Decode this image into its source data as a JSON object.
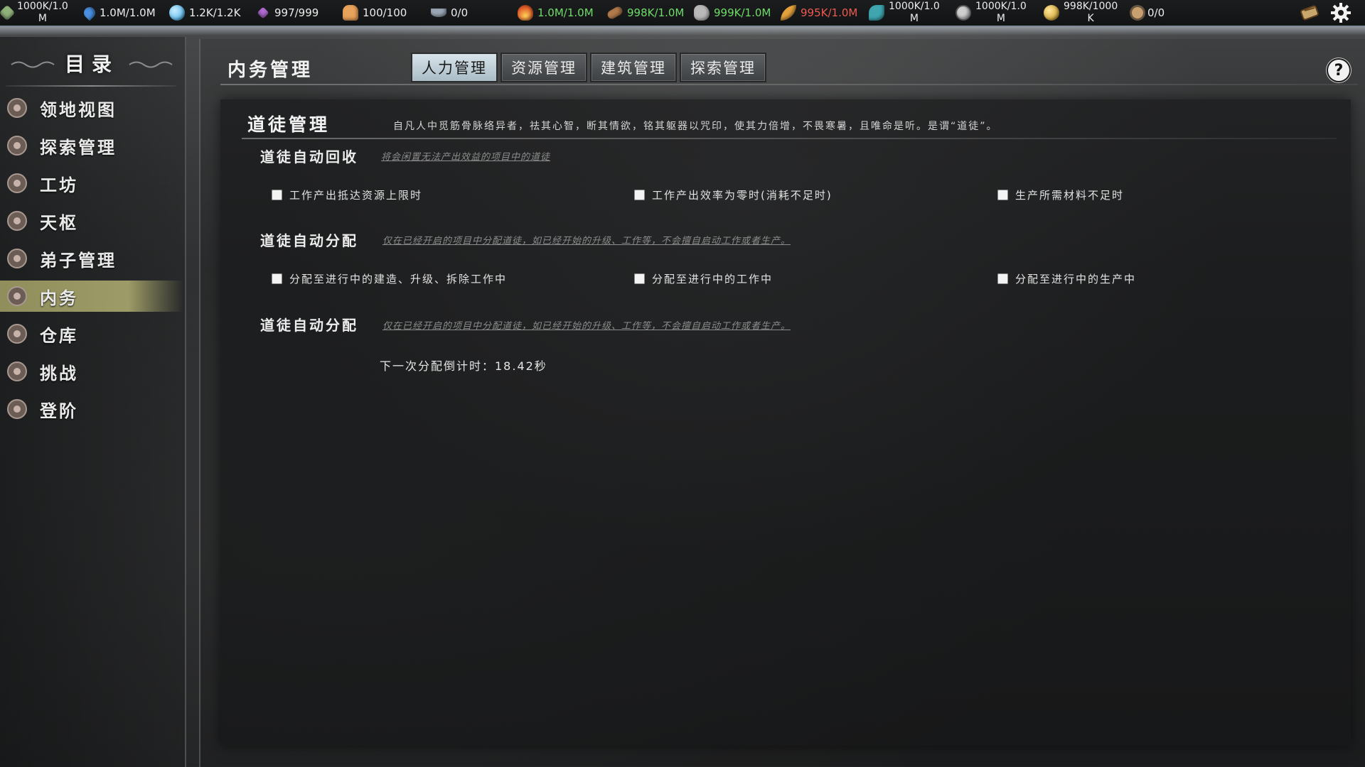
{
  "resources": [
    {
      "icon": "leaf-resource-icon",
      "value_line1": "1000K/1.0",
      "value_line2": "M",
      "style": "white",
      "color": "#8fb27a"
    },
    {
      "icon": "water-drop-icon",
      "value": "1.0M/1.0M",
      "style": "white",
      "color": "#4a8fe0"
    },
    {
      "icon": "spirit-orb-icon",
      "value": "1.2K/1.2K",
      "style": "white",
      "color": "#6fc3f0"
    },
    {
      "icon": "crystal-icon",
      "value": "997/999",
      "style": "white",
      "color": "#b06bd1"
    },
    {
      "icon": "disciples-icon",
      "value": "100/100",
      "style": "white",
      "color": "#e8a25a"
    },
    {
      "icon": "bowl-icon",
      "value": "0/0",
      "style": "white",
      "color": "#9aa6b4"
    },
    {
      "icon": "fire-icon",
      "value": "1.0M/1.0M",
      "style": "green",
      "color": "#e0602a"
    },
    {
      "icon": "wood-log-icon",
      "value": "998K/1.0M",
      "style": "green",
      "color": "#b07a4a"
    },
    {
      "icon": "stone-icon",
      "value": "999K/1.0M",
      "style": "green",
      "color": "#b9b9b9"
    },
    {
      "icon": "feather-icon",
      "value": "995K/1.0M",
      "style": "red",
      "color": "#e4a23c"
    },
    {
      "icon": "fish-icon",
      "value_line1": "1000K/1.0",
      "value_line2": "M",
      "style": "white",
      "color": "#3fa6b0"
    },
    {
      "icon": "skull-icon",
      "value_line1": "1000K/1.0",
      "value_line2": "M",
      "style": "white",
      "color": "#cfcfcf"
    },
    {
      "icon": "gold-coin-icon",
      "value_line1": "998K/1000",
      "value_line2": "K",
      "style": "white",
      "color": "#d9b24a"
    },
    {
      "icon": "gear-token-icon",
      "value": "0/0",
      "style": "white",
      "color": "#c8a070"
    }
  ],
  "sidebar": {
    "title": "目录",
    "items": [
      {
        "label": "领地视图",
        "name": "territory-view"
      },
      {
        "label": "探索管理",
        "name": "exploration"
      },
      {
        "label": "工坊",
        "name": "workshop"
      },
      {
        "label": "天枢",
        "name": "tianshu"
      },
      {
        "label": "弟子管理",
        "name": "disciples"
      },
      {
        "label": "内务",
        "name": "internal-affairs",
        "active": true
      },
      {
        "label": "仓库",
        "name": "warehouse"
      },
      {
        "label": "挑战",
        "name": "challenge"
      },
      {
        "label": "登阶",
        "name": "ascend"
      }
    ]
  },
  "main": {
    "title": "内务管理",
    "tabs": [
      {
        "label": "人力管理",
        "active": true
      },
      {
        "label": "资源管理",
        "active": false
      },
      {
        "label": "建筑管理",
        "active": false
      },
      {
        "label": "探索管理",
        "active": false
      }
    ],
    "help": "?"
  },
  "section": {
    "title": "道徒管理",
    "description": "自凡人中觅筋骨脉络异者，祛其心智，断其情欲，铭其躯器以咒印，使其力倍增，不畏寒暑，且唯命是听。是谓“道徒”。",
    "groups": [
      {
        "title": "道徒自动回收",
        "hint": "将会闲置无法产出效益的项目中的道徒",
        "options": [
          {
            "label": "工作产出抵达资源上限时",
            "checked": false
          },
          {
            "label": "工作产出效率为零时(消耗不足时)",
            "checked": false
          },
          {
            "label": "生产所需材料不足时",
            "checked": false
          }
        ]
      },
      {
        "title": "道徒自动分配",
        "hint": "仅在已经开启的项目中分配道徒，如已经开始的升级、工作等，不会擅自启动工作或者生产。",
        "options": [
          {
            "label": "分配至进行中的建造、升级、拆除工作中",
            "checked": false
          },
          {
            "label": "分配至进行中的工作中",
            "checked": false
          },
          {
            "label": "分配至进行中的生产中",
            "checked": false
          }
        ]
      },
      {
        "title": "道徒自动分配",
        "hint": "仅在已经开启的项目中分配道徒，如已经开始的升级、工作等，不会擅自启动工作或者生产。",
        "countdown": "下一次分配倒计时：18.42秒"
      }
    ]
  },
  "colors": {
    "active_nav": "#a9a76e",
    "active_tab": "#c8d8e0",
    "green_value": "#6fdc6a",
    "red_value": "#ee5a4f"
  }
}
